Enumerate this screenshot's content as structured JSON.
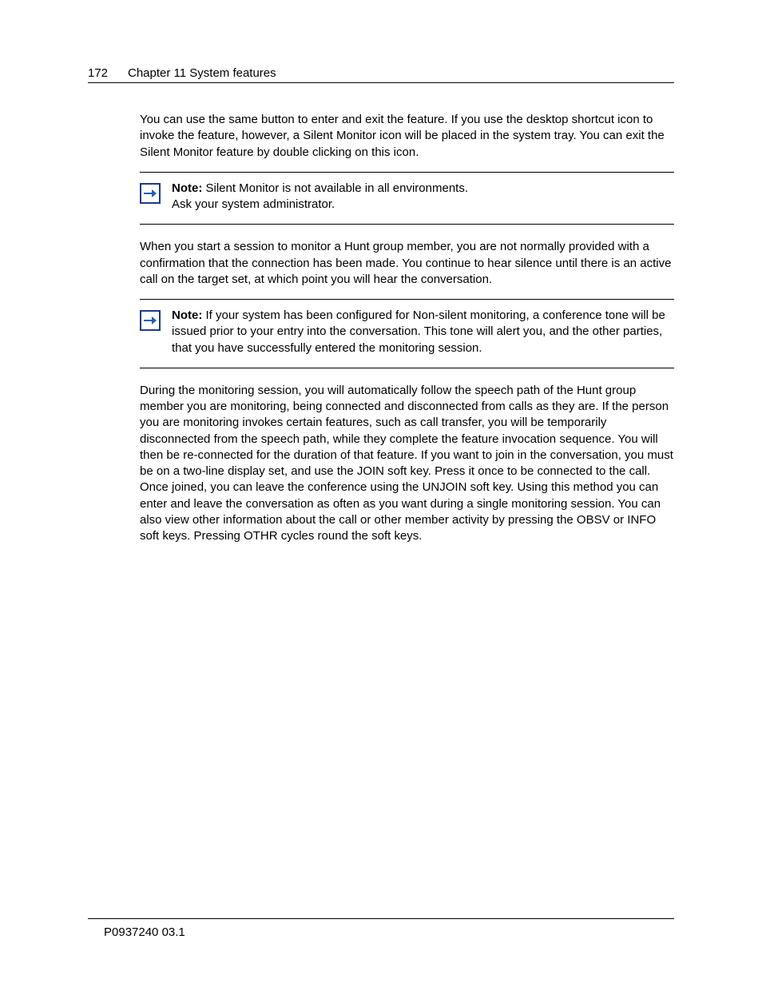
{
  "page": {
    "number": "172",
    "running_head": "Chapter 11  System features",
    "footer_id": "P0937240 03.1"
  },
  "content": {
    "intro": "You can use the same button to enter and exit the feature. If you use the desktop shortcut icon to invoke the feature, however, a Silent Monitor icon will be placed in the system tray. You can exit the Silent Monitor feature by double clicking on this icon.",
    "note1": {
      "label": "Note:",
      "body_line1": " Silent Monitor is not available in all environments. ",
      "body_line2": "Ask your system administrator."
    },
    "para2": "When you start a session to monitor a Hunt group member, you are not normally provided with a confirmation that the connection has been made. You continue to hear silence until there is an active call on the target set, at which point you will hear the conversation.",
    "note2": {
      "label": "Note:",
      "body": " If your system has been configured for Non-silent monitoring, a conference tone will be issued prior to your entry into the conversation. This tone will alert you, and the other parties, that you have successfully entered the monitoring session."
    },
    "para3": "During the monitoring session, you will automatically follow the speech path of the Hunt group member you are monitoring, being connected and disconnected from calls as they are. If the person you are monitoring invokes certain features, such as call transfer, you will be temporarily disconnected from the speech path, while they complete the feature invocation sequence. You will then be re-connected for the duration of that feature. If you want to join in the conversation, you must be on a two-line display set, and use the JOIN soft key. Press it once to be connected to the call. Once joined, you can leave the conference using the UNJOIN soft key. Using this method you can enter and leave the conversation as often as you want during a single monitoring session. You can also view other information about the call or other member activity by pressing the OBSV or INFO soft keys. Pressing OTHR cycles round the soft keys."
  },
  "icons": {
    "arrow_color": "#1f5fbf"
  }
}
